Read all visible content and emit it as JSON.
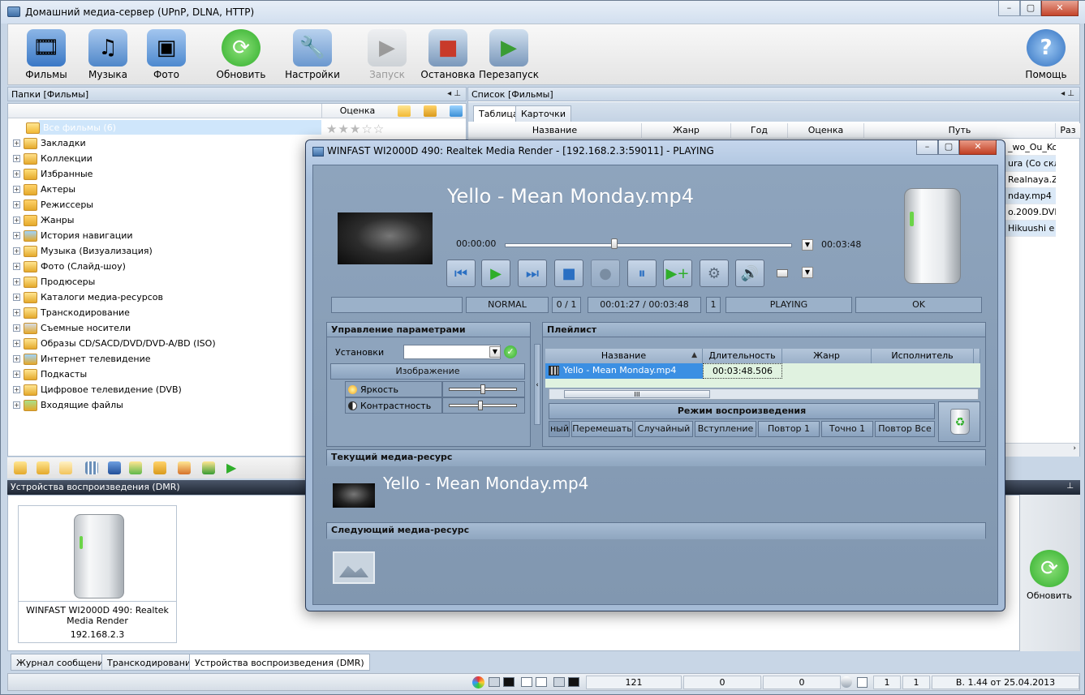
{
  "window": {
    "title": "Домашний медиа-сервер (UPnP, DLNA, HTTP)",
    "controls": [
      "–",
      "▢",
      "✕"
    ]
  },
  "toolbar": {
    "items": [
      {
        "label": "Фильмы",
        "icon": "film-icon",
        "color": "#3a78c6"
      },
      {
        "label": "Музыка",
        "icon": "music-icon",
        "color": "#4f87c9"
      },
      {
        "label": "Фото",
        "icon": "photo-icon",
        "color": "#4d89cf"
      },
      {
        "label": "Обновить",
        "icon": "refresh-icon",
        "color": "#2fae2a"
      },
      {
        "label": "Настройки",
        "icon": "settings-icon",
        "color": "#e0a21e"
      },
      {
        "label": "Запуск",
        "icon": "start-server-icon",
        "color": "#9aa7b4"
      },
      {
        "label": "Остановка",
        "icon": "stop-server-icon",
        "color": "#c83a2a"
      },
      {
        "label": "Перезапуск",
        "icon": "restart-server-icon",
        "color": "#3a9c34"
      }
    ],
    "help_label": "Помощь"
  },
  "folders": {
    "header": "Папки [Фильмы]",
    "col_rating": "Оценка",
    "root": "Все фильмы (6)",
    "items": [
      "Закладки",
      "Коллекции",
      "Избранные",
      "Актеры",
      "Режиссеры",
      "Жанры",
      "История навигации",
      "Музыка (Визуализация)",
      "Фото (Слайд-шоу)",
      "Продюсеры",
      "Каталоги медиа-ресурсов",
      "Транскодирование",
      "Съемные носители",
      "Образы CD/SACD/DVD/DVD-A/BD (ISO)",
      "Интернет телевидение",
      "Подкасты",
      "Цифровое телевидение (DVB)",
      "Входящие файлы"
    ]
  },
  "list": {
    "header": "Список [Фильмы]",
    "tabs": [
      "Таблица",
      "Карточки"
    ],
    "columns": [
      "Название",
      "Жанр",
      "Год",
      "Оценка",
      "Путь",
      "Раз"
    ],
    "path_fragments": [
      "_wo_Ou_Ko",
      "ura (Со скл",
      "Realnaya.Zi",
      "nday.mp4",
      "o.2009.DVD",
      "Hikuushi e"
    ]
  },
  "dmr": {
    "header": "Устройства воспроизведения (DMR)",
    "device_name": "WINFAST WI2000D 490: Realtek Media Render",
    "device_ip": "192.168.2.3",
    "refresh_label": "Обновить"
  },
  "bottom_tabs": [
    "Журнал сообщений",
    "Транскодирование",
    "Устройства воспроизведения (DMR)"
  ],
  "status": {
    "count1": "121",
    "count2": "0",
    "count3": "0",
    "n1": "1",
    "n2": "1",
    "version": "В. 1.44 от 25.04.2013"
  },
  "player": {
    "title": "WINFAST WI2000D 490: Realtek Media Render - [192.168.2.3:59011] - PLAYING",
    "now_playing": "Yello - Mean Monday.mp4",
    "time_start": "00:00:00",
    "time_end": "00:03:48",
    "seek_fraction": 0.38,
    "status_mode": "NORMAL",
    "status_track": "0 / 1",
    "status_position": "00:01:27 / 00:03:48",
    "status_num": "1",
    "status_state": "PLAYING",
    "status_ok": "OK",
    "params": {
      "title": "Управление параметрами",
      "preset_label": "Установки",
      "image_button": "Изображение",
      "brightness_label": "Яркость",
      "contrast_label": "Контрастность",
      "brightness_value": 0.5,
      "contrast_value": 0.47
    },
    "playlist": {
      "title": "Плейлист",
      "columns": [
        "Название",
        "Длительность",
        "Жанр",
        "Исполнитель"
      ],
      "rows": [
        {
          "name": "Yello - Mean Monday.mp4",
          "duration": "00:03:48.506",
          "genre": "",
          "artist": ""
        }
      ],
      "mode_title": "Режим воспроизведения",
      "modes": [
        "ный",
        "Перемешать",
        "Случайный",
        "Вступление",
        "Повтор 1",
        "Точно 1",
        "Повтор Все"
      ]
    },
    "current_title": "Текущий медиа-ресурс",
    "current_name": "Yello - Mean Monday.mp4",
    "next_title": "Следующий медиа-ресурс"
  }
}
